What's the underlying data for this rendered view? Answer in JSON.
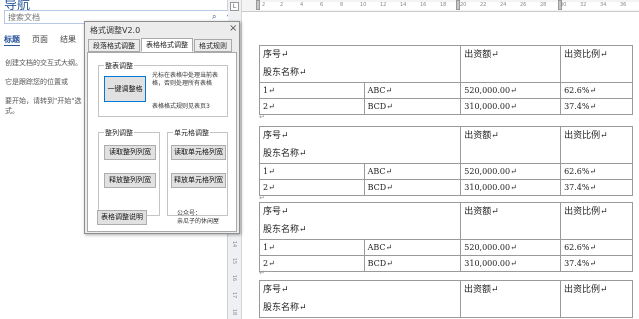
{
  "nav": {
    "title": "导航",
    "search_placeholder": "搜索文档",
    "tabs": [
      "标题",
      "页面",
      "结果"
    ],
    "paragraphs": [
      "创建文档的交互式大纲。",
      "它是跟踪您的位置或",
      "要开始，请转到\"开始\"选",
      "式。"
    ]
  },
  "ruler": {
    "corner": "L",
    "ticks": [
      "2",
      "2",
      "4",
      "6",
      "8",
      "10",
      "12",
      "14",
      "16",
      "18",
      "20",
      "22",
      "24",
      "26",
      "28",
      "30",
      "32",
      "34",
      "36"
    ],
    "vticks": [
      "1",
      "2",
      "3",
      "4",
      "5",
      "6",
      "7",
      "8",
      "9",
      "10",
      "11",
      "12",
      "13",
      "14",
      "15",
      "16",
      "17",
      "18"
    ]
  },
  "doc": {
    "para_mark": "↵",
    "tables": [
      {
        "header": {
          "col1_line1": "序号↵",
          "col1_line2": "股东名称↵",
          "col3": "出资额↵",
          "col4": "出资比例↵"
        },
        "rows": [
          [
            "1↵",
            "ABC↵",
            "520,000.00↵",
            "62.6%↵"
          ],
          [
            "2↵",
            "BCD↵",
            "310,000.00↵",
            "37.4%↵"
          ]
        ]
      },
      {
        "header": {
          "col1_line1": "序号↵",
          "col1_line2": "股东名称↵",
          "col3": "出资额↵",
          "col4": "出资比例↵"
        },
        "rows": [
          [
            "1↵",
            "ABC↵",
            "520,000.00↵",
            "62.6%↵"
          ],
          [
            "2↵",
            "BCD↵",
            "310,000.00↵",
            "37.4%↵"
          ]
        ]
      },
      {
        "header": {
          "col1_line1": "序号↵",
          "col1_line2": "股东名称↵",
          "col3": "出资额↵",
          "col4": "出资比例↵"
        },
        "rows": [
          [
            "1↵",
            "ABC↵",
            "520,000.00↵",
            "62.6%↵"
          ],
          [
            "2↵",
            "BCD↵",
            "310,000.00↵",
            "37.4%↵"
          ]
        ]
      },
      {
        "header": {
          "col1_line1": "序号↵",
          "col1_line2": "股东名称↵",
          "col3": "出资额↵",
          "col4": "出资比例↵"
        },
        "rows": [
          [
            "1↵",
            "ABC↵",
            "520,000.00↵",
            "62.6%↵"
          ]
        ]
      }
    ]
  },
  "dialog": {
    "title": "格式调整V2.0",
    "close": "×",
    "tabs": [
      "段落格式调整",
      "表格格式调整",
      "格式规则"
    ],
    "active_tab": 1,
    "group_whole": {
      "title": "整表调整",
      "button": "一键调整格",
      "hint": "光标在表格中处理当前表格，否则处理所有表格",
      "rule": "表格格式规则见表页3"
    },
    "group_col": {
      "title": "整列调整",
      "read": "读取整列列宽",
      "apply": "释放整列列宽"
    },
    "group_cell": {
      "title": "单元格调整",
      "read": "读取单元格列宽",
      "apply": "释放单元格列宽"
    },
    "help_button": "表格调整说明",
    "footer_line1": "公众号：",
    "footer_line2": "亲瓜子的休闲屋"
  }
}
